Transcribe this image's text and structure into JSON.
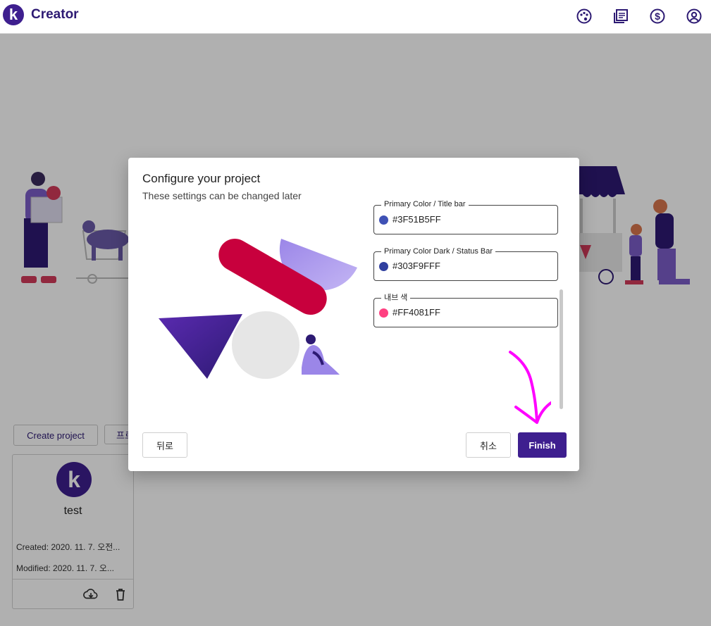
{
  "app": {
    "logo_letter": "k",
    "title": "Creator",
    "toolbar_icons": [
      "palette-icon",
      "library-icon",
      "dollar-icon",
      "account-icon"
    ]
  },
  "page": {
    "create_button": "Create project",
    "second_button_partial": "프로",
    "project": {
      "avatar_letter": "k",
      "name": "test",
      "created": "Created: 2020. 11. 7. 오전...",
      "modified": "Modified: 2020. 11. 7. 오...",
      "actions": [
        "cloud-download-icon",
        "trash-icon"
      ]
    }
  },
  "dialog": {
    "title": "Configure your project",
    "subtitle": "These settings can be changed later",
    "fields": [
      {
        "label": "Primary Color / Title bar",
        "value": "#3F51B5FF",
        "swatch": "#3F51B5"
      },
      {
        "label": "Primary Color Dark / Status Bar",
        "value": "#303F9FFF",
        "swatch": "#303F9F"
      },
      {
        "label": "내브 색",
        "value": "#FF4081FF",
        "swatch": "#FF4081"
      }
    ],
    "back_button": "뒤로",
    "cancel_button": "취소",
    "finish_button": "Finish"
  },
  "colors": {
    "brand": "#3E1F8F",
    "annotation": "#FF00FF"
  }
}
